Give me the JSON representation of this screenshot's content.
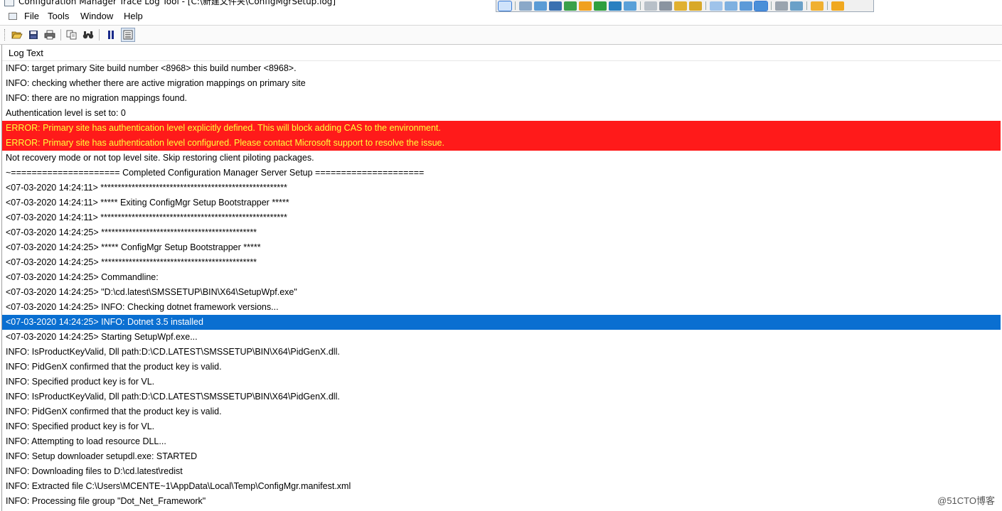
{
  "window": {
    "title": "Configuration Manager Trace Log Tool - [C:\\新建文件夹\\ConfigMgrSetup.log]"
  },
  "menu": {
    "items": [
      "File",
      "Tools",
      "Window",
      "Help"
    ]
  },
  "toolbar": {
    "buttons": [
      "open-icon",
      "save-icon",
      "print-icon",
      "copy-icon",
      "find-icon",
      "pause-icon",
      "log-view-icon"
    ]
  },
  "log": {
    "column_header": "Log Text",
    "rows": [
      {
        "text": "INFO: target primary Site build number <8968> this build number <8968>.",
        "state": "normal"
      },
      {
        "text": "INFO: checking whether there are active migration mappings on primary site",
        "state": "normal"
      },
      {
        "text": "INFO: there are no migration mappings found.",
        "state": "normal"
      },
      {
        "text": "Authentication level is set to: 0",
        "state": "normal"
      },
      {
        "text": "ERROR: Primary site has authentication level explicitly defined. This will block adding CAS to the environment.",
        "state": "error"
      },
      {
        "text": "ERROR: Primary site has authentication level configured. Please contact Microsoft support to resolve the issue.",
        "state": "error"
      },
      {
        "text": "Not recovery mode or not top level site. Skip restoring client piloting packages.",
        "state": "normal"
      },
      {
        "text": "~===================== Completed Configuration Manager Server Setup =====================",
        "state": "normal"
      },
      {
        "text": "<07-03-2020 14:24:11> ******************************************************",
        "state": "normal"
      },
      {
        "text": "<07-03-2020 14:24:11> *****   Exiting ConfigMgr Setup Bootstrapper    *****",
        "state": "normal"
      },
      {
        "text": "<07-03-2020 14:24:11> ******************************************************",
        "state": "normal"
      },
      {
        "text": "<07-03-2020 14:24:25> *********************************************",
        "state": "normal"
      },
      {
        "text": "<07-03-2020 14:24:25> *****   ConfigMgr Setup Bootstrapper    *****",
        "state": "normal"
      },
      {
        "text": "<07-03-2020 14:24:25> *********************************************",
        "state": "normal"
      },
      {
        "text": "<07-03-2020 14:24:25> Commandline:",
        "state": "normal"
      },
      {
        "text": "<07-03-2020 14:24:25> \"D:\\cd.latest\\SMSSETUP\\BIN\\X64\\SetupWpf.exe\"",
        "state": "normal"
      },
      {
        "text": "<07-03-2020 14:24:25> INFO: Checking dotnet framework versions...",
        "state": "normal"
      },
      {
        "text": "<07-03-2020 14:24:25> INFO: Dotnet 3.5 installed",
        "state": "selected"
      },
      {
        "text": "<07-03-2020 14:24:25> Starting SetupWpf.exe...",
        "state": "normal"
      },
      {
        "text": "INFO: IsProductKeyValid, Dll path:D:\\CD.LATEST\\SMSSETUP\\BIN\\X64\\PidGenX.dll.",
        "state": "normal"
      },
      {
        "text": "INFO: PidGenX confirmed that the product key is valid.",
        "state": "normal"
      },
      {
        "text": "INFO: Specified product key is for VL.",
        "state": "normal"
      },
      {
        "text": "INFO: IsProductKeyValid, Dll path:D:\\CD.LATEST\\SMSSETUP\\BIN\\X64\\PidGenX.dll.",
        "state": "normal"
      },
      {
        "text": "INFO: PidGenX confirmed that the product key is valid.",
        "state": "normal"
      },
      {
        "text": "INFO: Specified product key is for VL.",
        "state": "normal"
      },
      {
        "text": "INFO: Attempting to load resource DLL...",
        "state": "normal"
      },
      {
        "text": "INFO: Setup downloader setupdl.exe: STARTED",
        "state": "normal"
      },
      {
        "text": "INFO: Downloading files to D:\\cd.latest\\redist",
        "state": "normal"
      },
      {
        "text": "INFO: Extracted file C:\\Users\\MCENTE~1\\AppData\\Local\\Temp\\ConfigMgr.manifest.xml",
        "state": "normal"
      },
      {
        "text": "INFO: Processing file group \"Dot_Net_Framework\"",
        "state": "normal"
      }
    ]
  },
  "watermark": "@51CTO博客",
  "colors": {
    "error_bg": "#ff1a1a",
    "error_text": "#ffff3a",
    "selected_bg": "#0a6fd1",
    "selected_text": "#ffffff"
  }
}
